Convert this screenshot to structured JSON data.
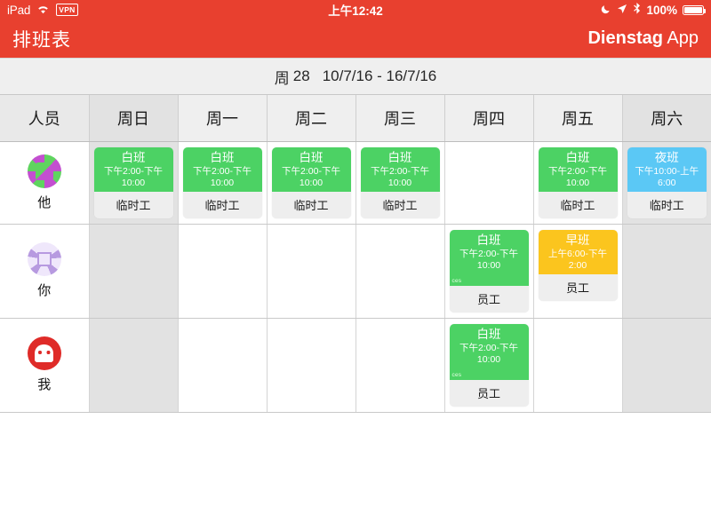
{
  "status_bar": {
    "device": "iPad",
    "wifi_icon": "wifi-icon",
    "vpn_label": "VPN",
    "time": "上午12:42",
    "moon_icon": "moon-icon",
    "location_icon": "location-arrow-icon",
    "bluetooth_icon": "bluetooth-icon",
    "battery_percent": "100%"
  },
  "nav": {
    "title": "排班表",
    "brand_bold": "Dienstag",
    "brand_light": "App"
  },
  "week_bar": {
    "week_label": "周",
    "week_number": "28",
    "date_range": "10/7/16 - 16/7/16"
  },
  "colors": {
    "accent_red": "#e8402f",
    "shift_day_green": "#4cd264",
    "shift_night_blue": "#5bc8f5",
    "shift_morning_yellow": "#fbc51e",
    "weekend_gray": "#e2e2e2",
    "header_gray": "#efefef"
  },
  "table": {
    "headers": [
      "人员",
      "周日",
      "周一",
      "周二",
      "周三",
      "周四",
      "周五",
      "周六"
    ],
    "weekend_columns": [
      1,
      7
    ],
    "rows": [
      {
        "person": {
          "name": "他",
          "avatar": "identicon-green-magenta"
        },
        "cells": [
          {
            "shift": {
              "title": "白班",
              "time": "下午2:00-下午 10:00",
              "role": "临时工",
              "color": "#4cd264",
              "note": ""
            }
          },
          {
            "shift": {
              "title": "白班",
              "time": "下午2:00-下午 10:00",
              "role": "临时工",
              "color": "#4cd264",
              "note": ""
            }
          },
          {
            "shift": {
              "title": "白班",
              "time": "下午2:00-下午 10:00",
              "role": "临时工",
              "color": "#4cd264",
              "note": ""
            }
          },
          {
            "shift": {
              "title": "白班",
              "time": "下午2:00-下午 10:00",
              "role": "临时工",
              "color": "#4cd264",
              "note": ""
            }
          },
          {
            "shift": null
          },
          {
            "shift": {
              "title": "白班",
              "time": "下午2:00-下午 10:00",
              "role": "临时工",
              "color": "#4cd264",
              "note": ""
            }
          },
          {
            "shift": {
              "title": "夜班",
              "time": "下午10:00-上午 6:00",
              "role": "临时工",
              "color": "#5bc8f5",
              "note": ""
            }
          }
        ]
      },
      {
        "person": {
          "name": "你",
          "avatar": "identicon-lavender"
        },
        "cells": [
          {
            "shift": null
          },
          {
            "shift": null
          },
          {
            "shift": null
          },
          {
            "shift": null
          },
          {
            "shift": {
              "title": "白班",
              "time": "下午2:00-下午 10:00",
              "role": "员工",
              "color": "#4cd264",
              "note": "ces"
            }
          },
          {
            "shift": {
              "title": "早班",
              "time": "上午6:00-下午2:00",
              "role": "员工",
              "color": "#fbc51e",
              "note": ""
            }
          },
          {
            "shift": null
          }
        ]
      },
      {
        "person": {
          "name": "我",
          "avatar": "ghost-red"
        },
        "cells": [
          {
            "shift": null
          },
          {
            "shift": null
          },
          {
            "shift": null
          },
          {
            "shift": null
          },
          {
            "shift": {
              "title": "白班",
              "time": "下午2:00-下午 10:00",
              "role": "员工",
              "color": "#4cd264",
              "note": "ces"
            }
          },
          {
            "shift": null
          },
          {
            "shift": null
          }
        ]
      }
    ]
  }
}
